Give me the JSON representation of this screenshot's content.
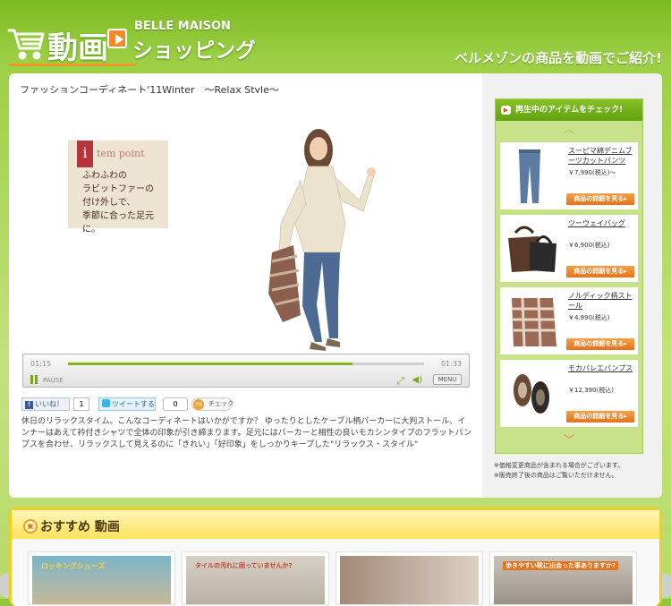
{
  "header": {
    "logo_main": "動画",
    "logo_brand": "BELLE MAISON",
    "logo_sub": "ショッピング",
    "tagline": "ベルメゾンの商品を動画でご紹介!"
  },
  "video": {
    "title": "ファッションコーディネート'11Winter　～Relax Style～",
    "item_point_label": "tem point",
    "item_point_badge": "i",
    "item_point_text": "ふわふわの\nラビットファーの\n付け外しで、\n季節に合った足元に。",
    "time_current": "01:15",
    "time_total": "01:33",
    "progress": 0.8,
    "pause_label": "PAUSE",
    "menu_label": "MENU"
  },
  "social": {
    "like_label": "いいね！",
    "like_count": "1",
    "tweet_label": "ツイートする",
    "tweet_count": "0",
    "mixi_label": "チェック",
    "mixi_logo": "m"
  },
  "description": "休日のリラックスタイム。こんなコーディネートはいかがですか？ ゆったりとしたケーブル柄パーカーに大判ストール、インナーはあえて衿付きシャツで全体の印象が引き締まります。足元にはパーカーと相性の良いモカシンタイプのフラットパンプスを合わせ、リラックスして見えるのに「きれい」「好印象」をしっかりキープした\"リラックス・スタイル\"",
  "sidebar": {
    "heading": "再生中のアイテムをチェック!",
    "detail_label": "商品の詳細を見る▸",
    "items": [
      {
        "name": "スーピマ綿デニムブーツカットパンツ",
        "price": "￥7,990(税込)～"
      },
      {
        "name": "ツーウェイバッグ",
        "price": "￥6,900(税込)"
      },
      {
        "name": "ノルディック柄ストール",
        "price": "￥4,990(税込)"
      },
      {
        "name": "モカパレエパンプス",
        "price": "￥12,390(税込)"
      }
    ],
    "notes": [
      "※価格変更商品が含まれる場合がございます。",
      "※販売終了後の商品はご覧いただけません。"
    ]
  },
  "recommend": {
    "title": "おすすめ 動画",
    "thumbs": [
      {
        "caption": "ロッキングシューズ"
      },
      {
        "caption": "タイルの汚れに困っていませんか?"
      },
      {
        "caption": ""
      },
      {
        "caption": "歩きやすい靴に出会った事ありますか?"
      }
    ]
  },
  "colors": {
    "accent_green": "#7cbb22",
    "button_orange": "#e4731b",
    "progress_green": "#85b51a"
  }
}
